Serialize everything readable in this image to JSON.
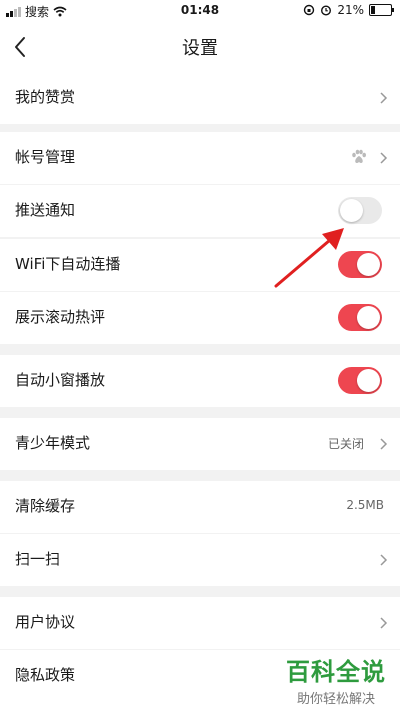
{
  "statusbar": {
    "carrier": "搜索",
    "time": "01:48",
    "battery": "21%"
  },
  "nav": {
    "title": "设置"
  },
  "rows": [
    {
      "label": "我的赞赏",
      "control": "chevron"
    },
    {
      "label": "帐号管理",
      "control": "chevron",
      "icon": "baidu-paw-icon"
    },
    {
      "label": "推送通知",
      "control": "toggle",
      "on": false
    },
    {
      "label": "WiFi下自动连播",
      "control": "toggle",
      "on": true
    },
    {
      "label": "展示滚动热评",
      "control": "toggle",
      "on": true
    },
    {
      "label": "自动小窗播放",
      "control": "toggle",
      "on": true
    },
    {
      "label": "青少年模式",
      "control": "chevron",
      "value": "已关闭"
    },
    {
      "label": "清除缓存",
      "control": "value",
      "value": "2.5MB"
    },
    {
      "label": "扫一扫",
      "control": "chevron"
    },
    {
      "label": "用户协议",
      "control": "chevron"
    },
    {
      "label": "隐私政策",
      "control": "chevron"
    }
  ],
  "watermark": {
    "title": "百科全说",
    "subtitle": "助你轻松解决"
  },
  "colors": {
    "toggle_on": "#ee4650",
    "toggle_off": "#e9e9e9",
    "annotation_arrow": "#e02020",
    "watermark": "#2e9b3e"
  }
}
